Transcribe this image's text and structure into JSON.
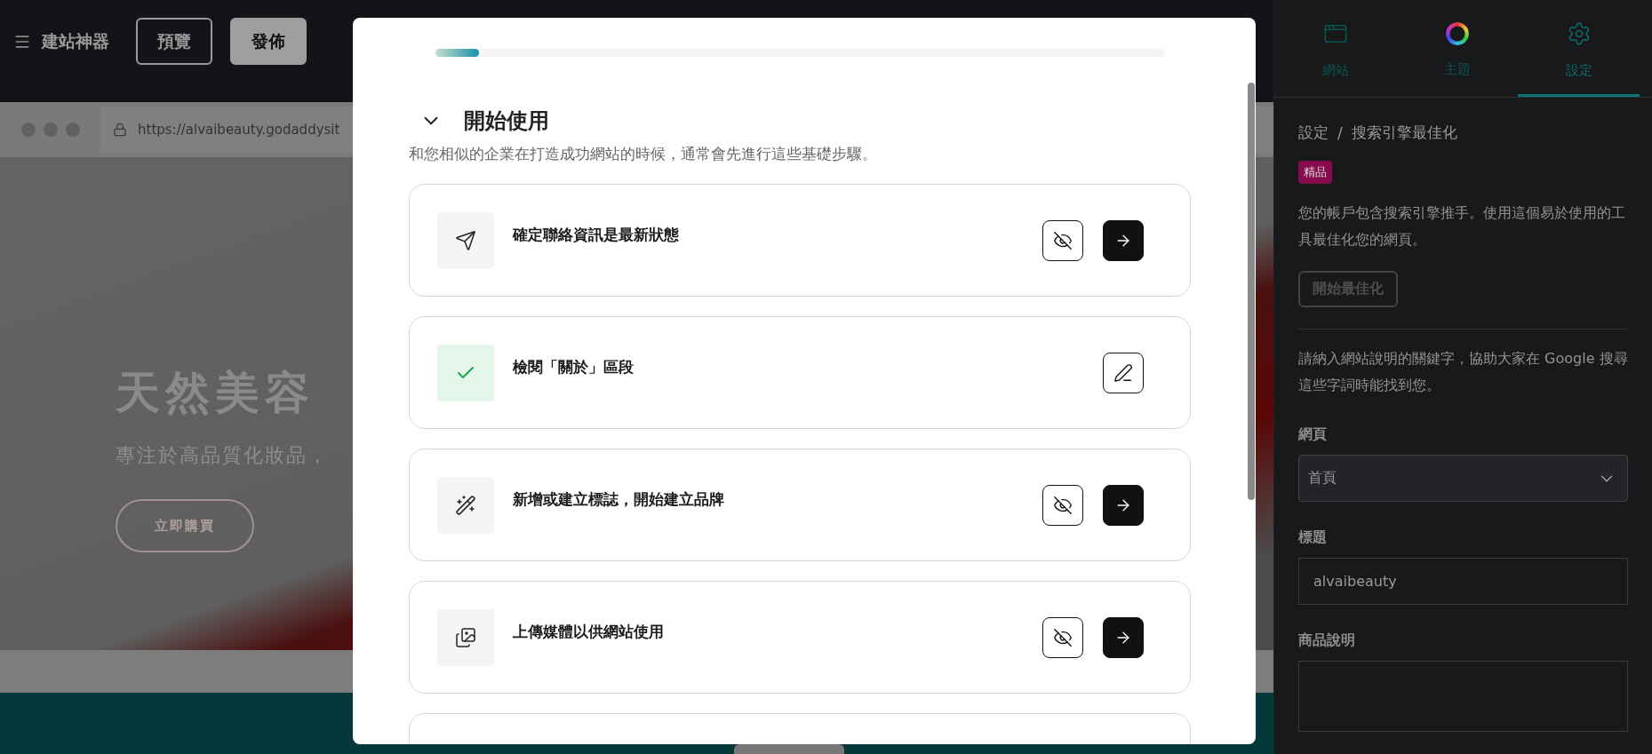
{
  "topbar": {
    "title": "建站神器",
    "buttons": [
      {
        "label": "預覽",
        "kind": "outline"
      },
      {
        "label": "發佈",
        "kind": "filled"
      }
    ]
  },
  "preview": {
    "url": "https://alvaibeauty.godaddysit",
    "hero_title": "天然美容",
    "hero_subtitle": "專注於高品質化妝品，",
    "cta": "立即購買"
  },
  "modal": {
    "progress": {
      "level": 0.06
    },
    "section": {
      "title": "開始使用",
      "expanded": true,
      "description": "和您相似的企業在打造成功網站的時候，通常會先進行這些基礎步驟。"
    },
    "tasks": [
      {
        "label": "確定聯絡資訊是最新狀態",
        "done": false
      },
      {
        "label": "檢閱「關於」區段",
        "done": true
      },
      {
        "label": "新增或建立標誌，開始建立品牌",
        "done": false
      },
      {
        "label": "上傳媒體以供網站使用",
        "done": false
      }
    ]
  },
  "sidebar": {
    "tabs": [
      {
        "label": "網站",
        "selected": false
      },
      {
        "label": "主題",
        "selected": false
      },
      {
        "label": "設定",
        "selected": true
      }
    ],
    "breadcrumb": [
      "設定",
      "/",
      "搜索引擎最佳化"
    ],
    "badge": "精品",
    "intro": "您的帳戶包含搜索引擎推手。使用這個易於使用的工具最佳化您的網頁。",
    "optimize_button": "開始最佳化",
    "hint": "請納入網站說明的關鍵字，協助大家在 Google 搜尋這些字詞時能找到您。",
    "fields": [
      {
        "label": "網頁",
        "kind": "select",
        "value": "首頁"
      },
      {
        "label": "標題",
        "kind": "text",
        "value": "alvaibeauty"
      },
      {
        "label": "商品說明",
        "kind": "textarea"
      }
    ]
  }
}
